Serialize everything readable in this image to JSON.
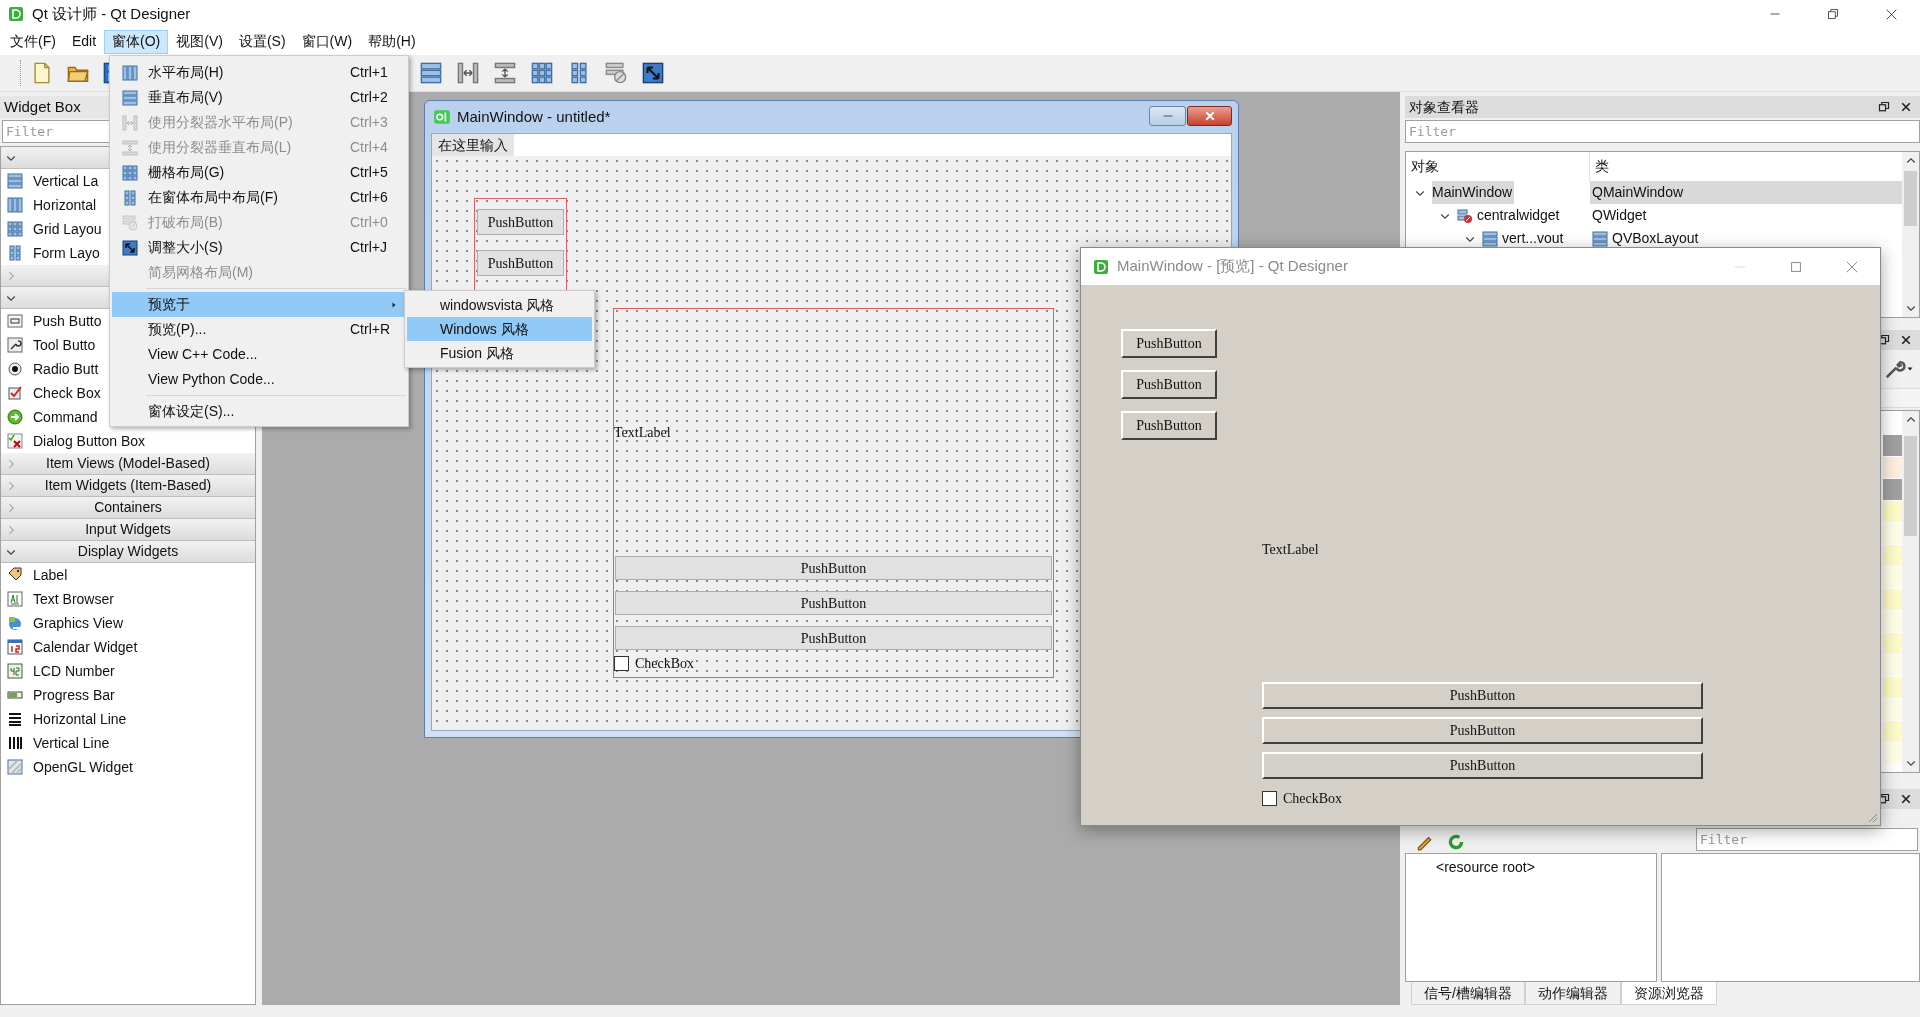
{
  "app_window": {
    "title": "Qt 设计师 - Qt Designer"
  },
  "menu_bar": [
    {
      "label": "文件(F)",
      "selected": false
    },
    {
      "label": "Edit",
      "selected": false
    },
    {
      "label": "窗体(O)",
      "selected": true
    },
    {
      "label": "视图(V)",
      "selected": false
    },
    {
      "label": "设置(S)",
      "selected": false
    },
    {
      "label": "窗口(W)",
      "selected": false
    },
    {
      "label": "帮助(H)",
      "selected": false
    }
  ],
  "widget_box": {
    "title": "Widget Box",
    "filter_placeholder": "Filter",
    "groups": [
      {
        "expanded": true,
        "items": [
          "Vertical La",
          "Horizontal",
          "Grid Layou",
          "Form Layo"
        ]
      },
      {
        "expanded": false
      },
      {
        "expanded": true,
        "items": [
          "Push Butto",
          "Tool Butto",
          "Radio Butt",
          "Check Box",
          "Command",
          "Dialog Button Box"
        ]
      },
      {
        "label": "Item Views (Model-Based)",
        "expanded": false
      },
      {
        "label": "Item Widgets (Item-Based)",
        "expanded": false
      },
      {
        "label": "Containers",
        "expanded": false
      },
      {
        "label": "Input Widgets",
        "expanded": false
      },
      {
        "label": "Display Widgets",
        "expanded": true,
        "items": [
          "Label",
          "Text Browser",
          "Graphics View",
          "Calendar Widget",
          "LCD Number",
          "Progress Bar",
          "Horizontal Line",
          "Vertical Line",
          "OpenGL Widget"
        ]
      }
    ]
  },
  "form_window": {
    "title": "MainWindow - untitled*",
    "menu_placeholder": "在这里输入",
    "left_buttons": [
      "PushButton",
      "PushButton"
    ],
    "label": "TextLabel",
    "buttons": [
      "PushButton",
      "PushButton",
      "PushButton"
    ],
    "checkbox": {
      "label": "CheckBox",
      "checked": false
    }
  },
  "object_inspector": {
    "title": "对象查看器",
    "filter_placeholder": "Filter",
    "columns": [
      "对象",
      "类"
    ],
    "tree": [
      {
        "object": "MainWindow",
        "class": "QMainWindow",
        "selected": true,
        "expanded": true,
        "children": [
          {
            "object": "centralwidget",
            "class": "QWidget",
            "selected": false,
            "expanded": true,
            "children": [
              {
                "object": "vert...vout",
                "class": "QVBoxLayout",
                "selected": false,
                "expanded": true
              }
            ]
          }
        ]
      }
    ]
  },
  "resource_browser": {
    "filter_placeholder": "Filter",
    "root": "<resource root>"
  },
  "bottom_tabs": [
    {
      "label": "信号/槽编辑器",
      "selected": false
    },
    {
      "label": "动作编辑器",
      "selected": false
    },
    {
      "label": "资源浏览器",
      "selected": true
    }
  ],
  "preview_window": {
    "title": "MainWindow - [预览] - Qt Designer",
    "top_buttons": [
      "PushButton",
      "PushButton",
      "PushButton"
    ],
    "label": "TextLabel",
    "buttons": [
      "PushButton",
      "PushButton",
      "PushButton"
    ],
    "checkbox": {
      "label": "CheckBox",
      "checked": false
    }
  },
  "form_menu": [
    {
      "kind": "item",
      "label": "水平布局(H)",
      "shortcut": "Ctrl+1",
      "disabled": false,
      "selected": false
    },
    {
      "kind": "item",
      "label": "垂直布局(V)",
      "shortcut": "Ctrl+2",
      "disabled": false,
      "selected": false
    },
    {
      "kind": "item",
      "label": "使用分裂器水平布局(P)",
      "shortcut": "Ctrl+3",
      "disabled": true,
      "selected": false
    },
    {
      "kind": "item",
      "label": "使用分裂器垂直布局(L)",
      "shortcut": "Ctrl+4",
      "disabled": true,
      "selected": false
    },
    {
      "kind": "item",
      "label": "栅格布局(G)",
      "shortcut": "Ctrl+5",
      "disabled": false,
      "selected": false
    },
    {
      "kind": "item",
      "label": "在窗体布局中布局(F)",
      "shortcut": "Ctrl+6",
      "disabled": false,
      "selected": false
    },
    {
      "kind": "item",
      "label": "打破布局(B)",
      "shortcut": "Ctrl+0",
      "disabled": true,
      "selected": false
    },
    {
      "kind": "item",
      "label": "调整大小(S)",
      "shortcut": "Ctrl+J",
      "disabled": false,
      "selected": false
    },
    {
      "kind": "item",
      "label": "简易网格布局(M)",
      "disabled": true,
      "selected": false
    },
    {
      "kind": "separator"
    },
    {
      "kind": "submenu",
      "label": "预览于",
      "disabled": false,
      "selected": true
    },
    {
      "kind": "item",
      "label": "预览(P)...",
      "shortcut": "Ctrl+R",
      "disabled": false,
      "selected": false
    },
    {
      "kind": "item",
      "label": "View C++ Code...",
      "disabled": false,
      "selected": false
    },
    {
      "kind": "item",
      "label": "View Python Code...",
      "disabled": false,
      "selected": false
    },
    {
      "kind": "separator"
    },
    {
      "kind": "item",
      "label": "窗体设定(S)...",
      "disabled": false,
      "selected": false
    }
  ],
  "preview_submenu": [
    {
      "label": "windowsvista 风格",
      "selected": false
    },
    {
      "label": "Windows 风格",
      "selected": true
    },
    {
      "label": "Fusion 风格",
      "selected": false
    }
  ]
}
